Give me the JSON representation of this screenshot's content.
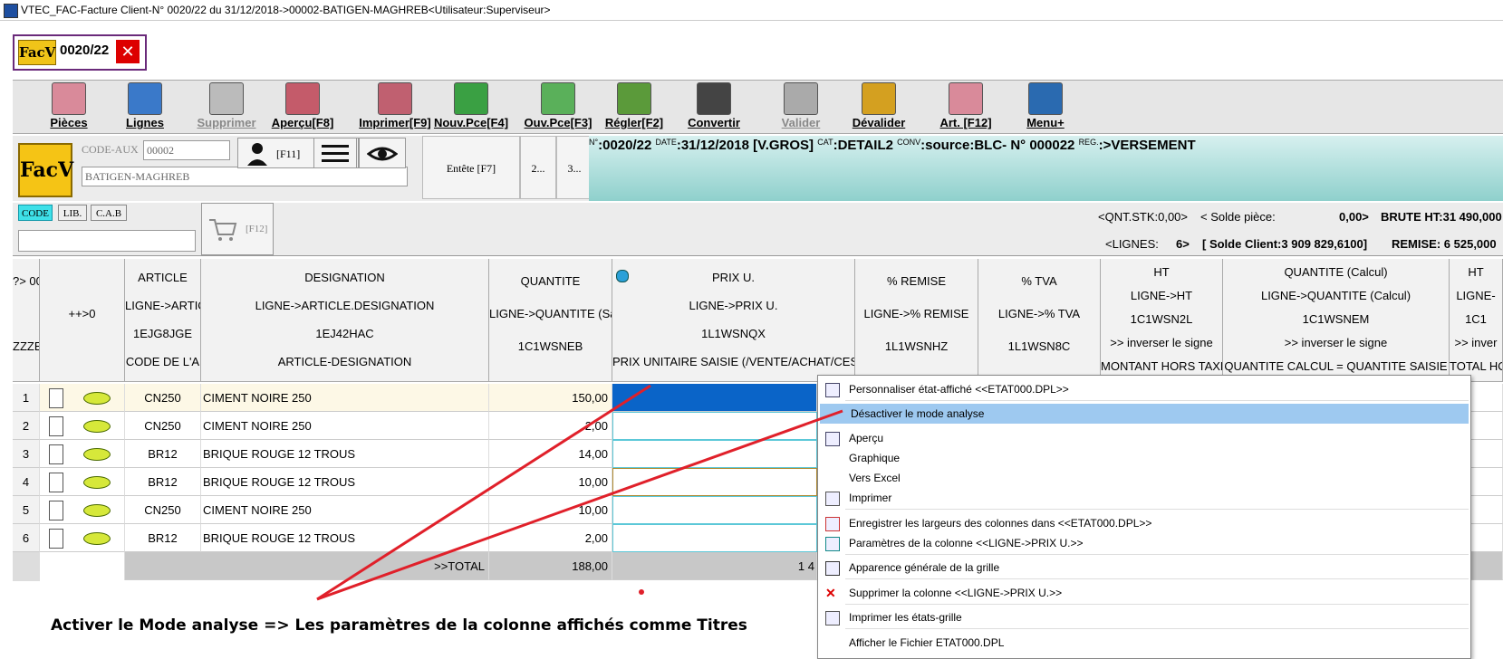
{
  "window": {
    "title": "VTEC_FAC-Facture Client-N° 0020/22 du 31/12/2018->00002-BATIGEN-MAGHREB<Utilisateur:Superviseur>"
  },
  "doc_tab": {
    "badge": "FacV",
    "number": "0020/22",
    "close": "✕"
  },
  "toolbar": [
    {
      "label": "Pièces",
      "icon": "pieces-icon",
      "color": "#d98a9a",
      "enabled": true
    },
    {
      "label": "Lignes",
      "icon": "magnifier-icon",
      "color": "#3a79c9",
      "enabled": true
    },
    {
      "label": "Supprimer",
      "icon": "trash-icon",
      "color": "#bbbbbb",
      "enabled": false
    },
    {
      "label": "Aperçu[F8]",
      "icon": "preview-icon",
      "color": "#c45b6a",
      "enabled": true
    },
    {
      "label": "Imprimer[F9]",
      "icon": "printer-icon",
      "color": "#c06070",
      "enabled": true
    },
    {
      "label": "Nouv.Pce[F4]",
      "icon": "new-doc-icon",
      "color": "#3aa043",
      "enabled": true
    },
    {
      "label": "Ouv.Pce[F3]",
      "icon": "open-doc-icon",
      "color": "#5ab05a",
      "enabled": true
    },
    {
      "label": "Régler[F2]",
      "icon": "money-icon",
      "color": "#5b9a3a",
      "enabled": true
    },
    {
      "label": "Convertir",
      "icon": "convert-icon",
      "color": "#444444",
      "enabled": true
    },
    {
      "label": "Valider",
      "icon": "validate-icon",
      "color": "#aaaaaa",
      "enabled": false
    },
    {
      "label": "Dévalider",
      "icon": "unvalidate-icon",
      "color": "#d4a020",
      "enabled": true
    },
    {
      "label": "Art. [F12]",
      "icon": "articles-icon",
      "color": "#d98a9a",
      "enabled": true
    },
    {
      "label": "Menu+",
      "icon": "menu-lines-icon",
      "color": "#2a6ab0",
      "enabled": true
    }
  ],
  "header": {
    "badge": "FacV",
    "code_aux_label": "CODE-AUX",
    "code_aux_value": "00002",
    "client_name": "BATIGEN-MAGHREB",
    "f11": "[F11]",
    "entete": "Entête [F7]",
    "tab2": "2...",
    "tab3": "3...",
    "info": {
      "n_label": "N°",
      "n_value": ":0020/22",
      "date_label": "DATE",
      "date_value": ":31/12/2018",
      "vgros": "[V.GROS]",
      "cat_label": "CAT",
      "cat_value": ":DETAIL2",
      "conv_label": "CONV",
      "conv_value": ":source:BLC- N° 000022",
      "reg_label": "REG.",
      "reg_value": ":>VERSEMENT"
    }
  },
  "search": {
    "btn_code": "CODE",
    "btn_lib": "LIB.",
    "btn_cab": "C.A.B",
    "f12": "[F12]",
    "value": ""
  },
  "totals": {
    "qnt_stk": "<QNT.STK:0,00>",
    "solde_piece_label": "< Solde pièce:",
    "solde_piece_value": "0,00>",
    "brute_ht": "BRUTE HT:31 490,000",
    "lignes_label": "<LIGNES:",
    "lignes_value": "6>",
    "solde_client": "[ Solde Client:3 909 829,6100]",
    "remise": "REMISE:  6 525,000"
  },
  "columns": [
    {
      "lines": [
        "?> 00",
        "",
        "ZZZE"
      ]
    },
    {
      "lines": [
        "",
        "++>0",
        ""
      ]
    },
    {
      "lines": [
        "ARTICLE",
        "LIGNE->ARTIC",
        "1EJG8JGE",
        "CODE DE L'A"
      ]
    },
    {
      "lines": [
        "DESIGNATION",
        "LIGNE->ARTICLE.DESIGNATION",
        "1EJ42HAC",
        "ARTICLE-DESIGNATION"
      ]
    },
    {
      "lines": [
        "QUANTITE",
        "LIGNE->QUANTITE (Sa",
        "1C1WSNEB"
      ]
    },
    {
      "lines": [
        "PRIX U.",
        "LIGNE->PRIX U.",
        "1L1WSNQX",
        "PRIX UNITAIRE SAISIE  (/VENTE/ACHAT/CES"
      ]
    },
    {
      "lines": [
        "% REMISE",
        "LIGNE->% REMISE",
        "1L1WSNHZ"
      ]
    },
    {
      "lines": [
        "% TVA",
        "LIGNE->% TVA",
        "1L1WSN8C"
      ]
    },
    {
      "lines": [
        "HT",
        "LIGNE->HT",
        "1C1WSN2L",
        ">> inverser le signe",
        "MONTANT HORS TAXE"
      ]
    },
    {
      "lines": [
        "QUANTITE (Calcul)",
        "LIGNE->QUANTITE (Calcul)",
        "1C1WSNEM",
        ">> inverser le signe",
        "QUANTITE CALCUL =  QUANTITE SAISIE"
      ]
    },
    {
      "lines": [
        "HT",
        "LIGNE-",
        "1C1",
        ">> inver",
        "TOTAL HO"
      ]
    }
  ],
  "rows": [
    {
      "n": "1",
      "code": "CN250",
      "designation": "CIMENT NOIRE 250",
      "qty": "150,00"
    },
    {
      "n": "2",
      "code": "CN250",
      "designation": "CIMENT NOIRE 250",
      "qty": "2,00"
    },
    {
      "n": "3",
      "code": "BR12",
      "designation": "BRIQUE ROUGE 12 TROUS",
      "qty": "14,00"
    },
    {
      "n": "4",
      "code": "BR12",
      "designation": "BRIQUE ROUGE 12 TROUS",
      "qty": "10,00"
    },
    {
      "n": "5",
      "code": "CN250",
      "designation": "CIMENT NOIRE 250",
      "qty": "10,00"
    },
    {
      "n": "6",
      "code": "BR12",
      "designation": "BRIQUE ROUGE 12 TROUS",
      "qty": "2,00"
    }
  ],
  "total_row": {
    "label": ">>TOTAL",
    "qty": "188,00",
    "prix_partial": "1 4"
  },
  "context_menu": [
    {
      "label": "Personnaliser état-affiché <<ETAT000.DPL>>",
      "icon": "customize-icon"
    },
    {
      "label": "Désactiver le mode analyse",
      "icon": "",
      "highlight": true
    },
    {
      "label": "Aperçu",
      "icon": "preview-icon"
    },
    {
      "label": "Graphique",
      "icon": ""
    },
    {
      "label": "Vers Excel",
      "icon": ""
    },
    {
      "label": "Imprimer",
      "icon": "printer-icon"
    },
    {
      "label": "Enregistrer les largeurs des colonnes dans <<ETAT000.DPL>>",
      "icon": "columns-icon"
    },
    {
      "label": "Paramètres de la colonne <<LIGNE->PRIX U.>>",
      "icon": "column-settings-icon"
    },
    {
      "label": "Apparence générale de la grille",
      "icon": "tools-icon"
    },
    {
      "label": "Supprimer la colonne <<LIGNE->PRIX U.>>",
      "icon": "delete-x-icon"
    },
    {
      "label": "Imprimer les états-grille",
      "icon": "printer-icon"
    },
    {
      "label": "Afficher le Fichier ETAT000.DPL",
      "icon": ""
    }
  ],
  "annotation": {
    "caption": "Activer le Mode analyse =>  Les paramètres de la colonne affichés comme Titres",
    "color": "#e0202a"
  },
  "colors": {
    "accent_teal": "#8fd0cc",
    "selection_blue": "#0a64c8",
    "menu_highlight": "#9ec9f0",
    "badge_yellow": "#f0c419"
  }
}
